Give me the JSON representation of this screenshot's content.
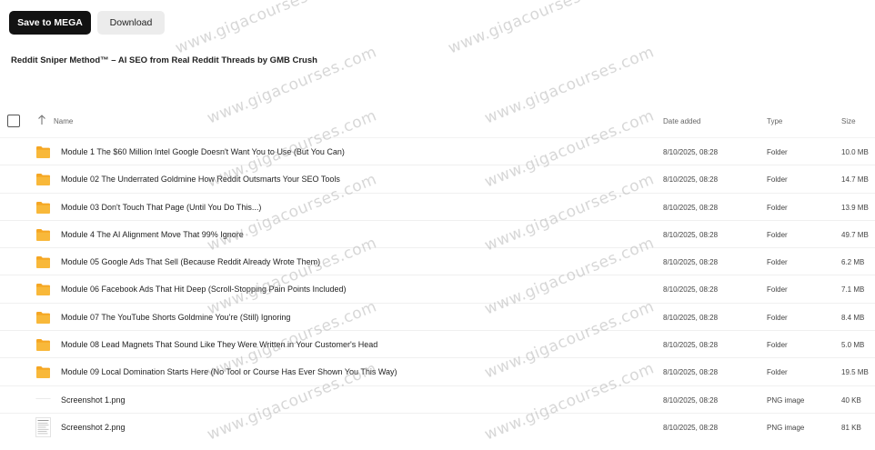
{
  "toolbar": {
    "save_label": "Save to MEGA",
    "download_label": "Download"
  },
  "folder_title": "Reddit Sniper Method™ – AI SEO from Real Reddit Threads by GMB Crush",
  "columns": {
    "name": "Name",
    "date": "Date added",
    "type": "Type",
    "size": "Size"
  },
  "rows": [
    {
      "name": "Module 1 The $60 Million Intel Google Doesn't Want You to Use (But You Can)",
      "date": "8/10/2025, 08:28",
      "type": "Folder",
      "size": "10.0 MB",
      "icon": "folder-icon"
    },
    {
      "name": "Module 02 The Underrated Goldmine How Reddit Outsmarts Your SEO Tools",
      "date": "8/10/2025, 08:28",
      "type": "Folder",
      "size": "14.7 MB",
      "icon": "folder-icon"
    },
    {
      "name": "Module 03 Don't Touch That Page (Until You Do This...)",
      "date": "8/10/2025, 08:28",
      "type": "Folder",
      "size": "13.9 MB",
      "icon": "folder-icon"
    },
    {
      "name": "Module 4 The AI Alignment Move That 99% Ignore",
      "date": "8/10/2025, 08:28",
      "type": "Folder",
      "size": "49.7 MB",
      "icon": "folder-icon"
    },
    {
      "name": "Module 05 Google Ads That Sell (Because Reddit Already Wrote Them)",
      "date": "8/10/2025, 08:28",
      "type": "Folder",
      "size": "6.2 MB",
      "icon": "folder-icon"
    },
    {
      "name": "Module 06 Facebook Ads That Hit Deep (Scroll-Stopping Pain Points Included)",
      "date": "8/10/2025, 08:28",
      "type": "Folder",
      "size": "7.1 MB",
      "icon": "folder-icon"
    },
    {
      "name": "Module 07 The YouTube Shorts Goldmine You're (Still) Ignoring",
      "date": "8/10/2025, 08:28",
      "type": "Folder",
      "size": "8.4 MB",
      "icon": "folder-icon"
    },
    {
      "name": "Module 08 Lead Magnets That Sound Like They Were Written in Your Customer's Head",
      "date": "8/10/2025, 08:28",
      "type": "Folder",
      "size": "5.0 MB",
      "icon": "folder-icon"
    },
    {
      "name": "Module 09 Local Domination Starts Here (No Tool or Course Has Ever Shown You This Way)",
      "date": "8/10/2025, 08:28",
      "type": "Folder",
      "size": "19.5 MB",
      "icon": "folder-icon"
    },
    {
      "name": "Screenshot 1.png",
      "date": "8/10/2025, 08:28",
      "type": "PNG image",
      "size": "40 KB",
      "icon": "image-thumbnail-icon"
    },
    {
      "name": "Screenshot 2.png",
      "date": "8/10/2025, 08:28",
      "type": "PNG image",
      "size": "81 KB",
      "icon": "document-thumbnail-icon"
    }
  ],
  "watermark_text": "www.gigacourses.com",
  "colors": {
    "save_button": "#121212",
    "download_button": "#ececec",
    "folder": "#f5a623"
  }
}
